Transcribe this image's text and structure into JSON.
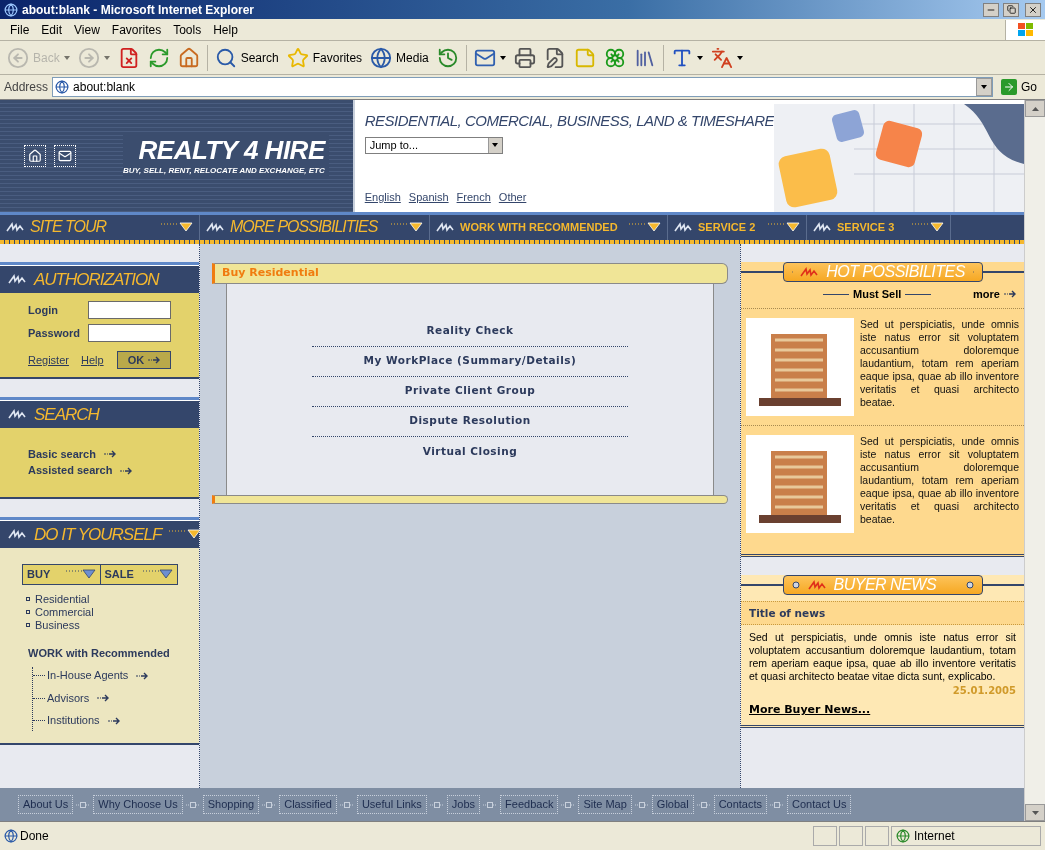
{
  "window": {
    "title": "about:blank - Microsoft Internet Explorer"
  },
  "menu_bar": [
    "File",
    "Edit",
    "View",
    "Favorites",
    "Tools",
    "Help"
  ],
  "toolbar": [
    {
      "kind": "back",
      "label": "Back",
      "disabled": true,
      "menu": true
    },
    {
      "kind": "forward",
      "disabled": true,
      "menu": true
    },
    {
      "kind": "stop",
      "disabled": false,
      "menu": false
    },
    {
      "kind": "refresh",
      "disabled": false,
      "menu": false
    },
    {
      "kind": "home",
      "disabled": false,
      "menu": false
    },
    {
      "kind": "search",
      "label": "Search",
      "disabled": false,
      "menu": false
    },
    {
      "kind": "favorites",
      "label": "Favorites",
      "disabled": false,
      "menu": false
    },
    {
      "kind": "media",
      "label": "Media",
      "disabled": false,
      "menu": false
    },
    {
      "kind": "history",
      "disabled": false,
      "menu": false
    },
    {
      "kind": "mail",
      "disabled": false,
      "menu": true
    },
    {
      "kind": "print",
      "disabled": false,
      "menu": false
    },
    {
      "kind": "edit",
      "disabled": false,
      "menu": false
    },
    {
      "kind": "note",
      "disabled": false,
      "menu": false
    },
    {
      "kind": "flower",
      "disabled": false,
      "menu": false
    },
    {
      "kind": "research",
      "disabled": false,
      "menu": false
    },
    {
      "kind": "font",
      "disabled": false,
      "menu": true
    },
    {
      "kind": "translate",
      "disabled": false,
      "menu": true
    }
  ],
  "address_bar": {
    "label": "Address",
    "value": "about:blank",
    "go": "Go"
  },
  "header": {
    "logo_title": "REALTY 4 HIRE",
    "tagline": "BUY, SELL, RENT, RELOCATE AND EXCHANGE, ETC",
    "categories": "RESIDENTIAL, COMERCIAL, BUSINESS, LAND & TIMESHARE",
    "jump_to": "Jump to...",
    "languages": [
      "English",
      "Spanish",
      "French",
      "Other"
    ]
  },
  "nav": [
    {
      "label": "SITE TOUR",
      "kind": "large"
    },
    {
      "label": "MORE POSSIBILITIES",
      "kind": "large"
    },
    {
      "label": "WORK WITH RECOMMENDED",
      "kind": "small"
    },
    {
      "label": "SERVICE 2",
      "kind": "small"
    },
    {
      "label": "SERVICE 3",
      "kind": "small"
    }
  ],
  "authorization": {
    "title": "AUTHORIZATION",
    "login_label": "Login",
    "password_label": "Password",
    "register": "Register",
    "help": "Help",
    "ok": "OK"
  },
  "search": {
    "title": "SEARCH",
    "links": [
      "Basic search",
      "Assisted search"
    ]
  },
  "do_it_yourself": {
    "title": "DO IT YOURSELF",
    "buy": "BUY",
    "sale": "SALE",
    "items": [
      "Residential",
      "Commercial",
      "Business"
    ],
    "work_title": "WORK with Recommended",
    "work_items": [
      "In-House Agents",
      "Advisors",
      "Institutions"
    ]
  },
  "center": {
    "title": "Buy Residential",
    "items": [
      "Reality Check",
      "My WorkPlace (Summary/Details)",
      "Private Client Group",
      "Dispute Resolution",
      "Virtual Closing"
    ]
  },
  "hot_possibilities": {
    "title": "HOT POSSIBILITES",
    "must_sell": "Must Sell",
    "more": "more",
    "listings": [
      {
        "text": "Sed ut perspiciatis, unde omnis iste natus error sit voluptatem accusantium doloremque laudantium, totam rem aperiam eaque ipsa, quae ab illo inventore veritatis et quasi architecto beatae."
      },
      {
        "text": "Sed ut perspiciatis, unde omnis iste natus error sit voluptatem accusantium doloremque laudantium, totam rem aperiam eaque ipsa, quae ab illo inventore veritatis et quasi architecto beatae."
      }
    ]
  },
  "buyer_news": {
    "title": "BUYER NEWS",
    "news_title": "Title of news",
    "text": "Sed ut perspiciatis, unde omnis iste natus error sit voluptatem accusantium doloremque laudantium, totam rem aperiam eaque ipsa, quae ab illo inventore veritatis et quasi architecto beatae vitae dicta sunt, explicabo.",
    "date": "25.01.2005",
    "more": "More Buyer News..."
  },
  "footer": [
    "About Us",
    "Why Choose Us",
    "Shopping",
    "Classified",
    "Useful Links",
    "Jobs",
    "Feedback",
    "Site Map",
    "Global",
    "Contacts",
    "Contact Us"
  ],
  "status_bar": {
    "text": "Done",
    "zone": "Internet"
  }
}
